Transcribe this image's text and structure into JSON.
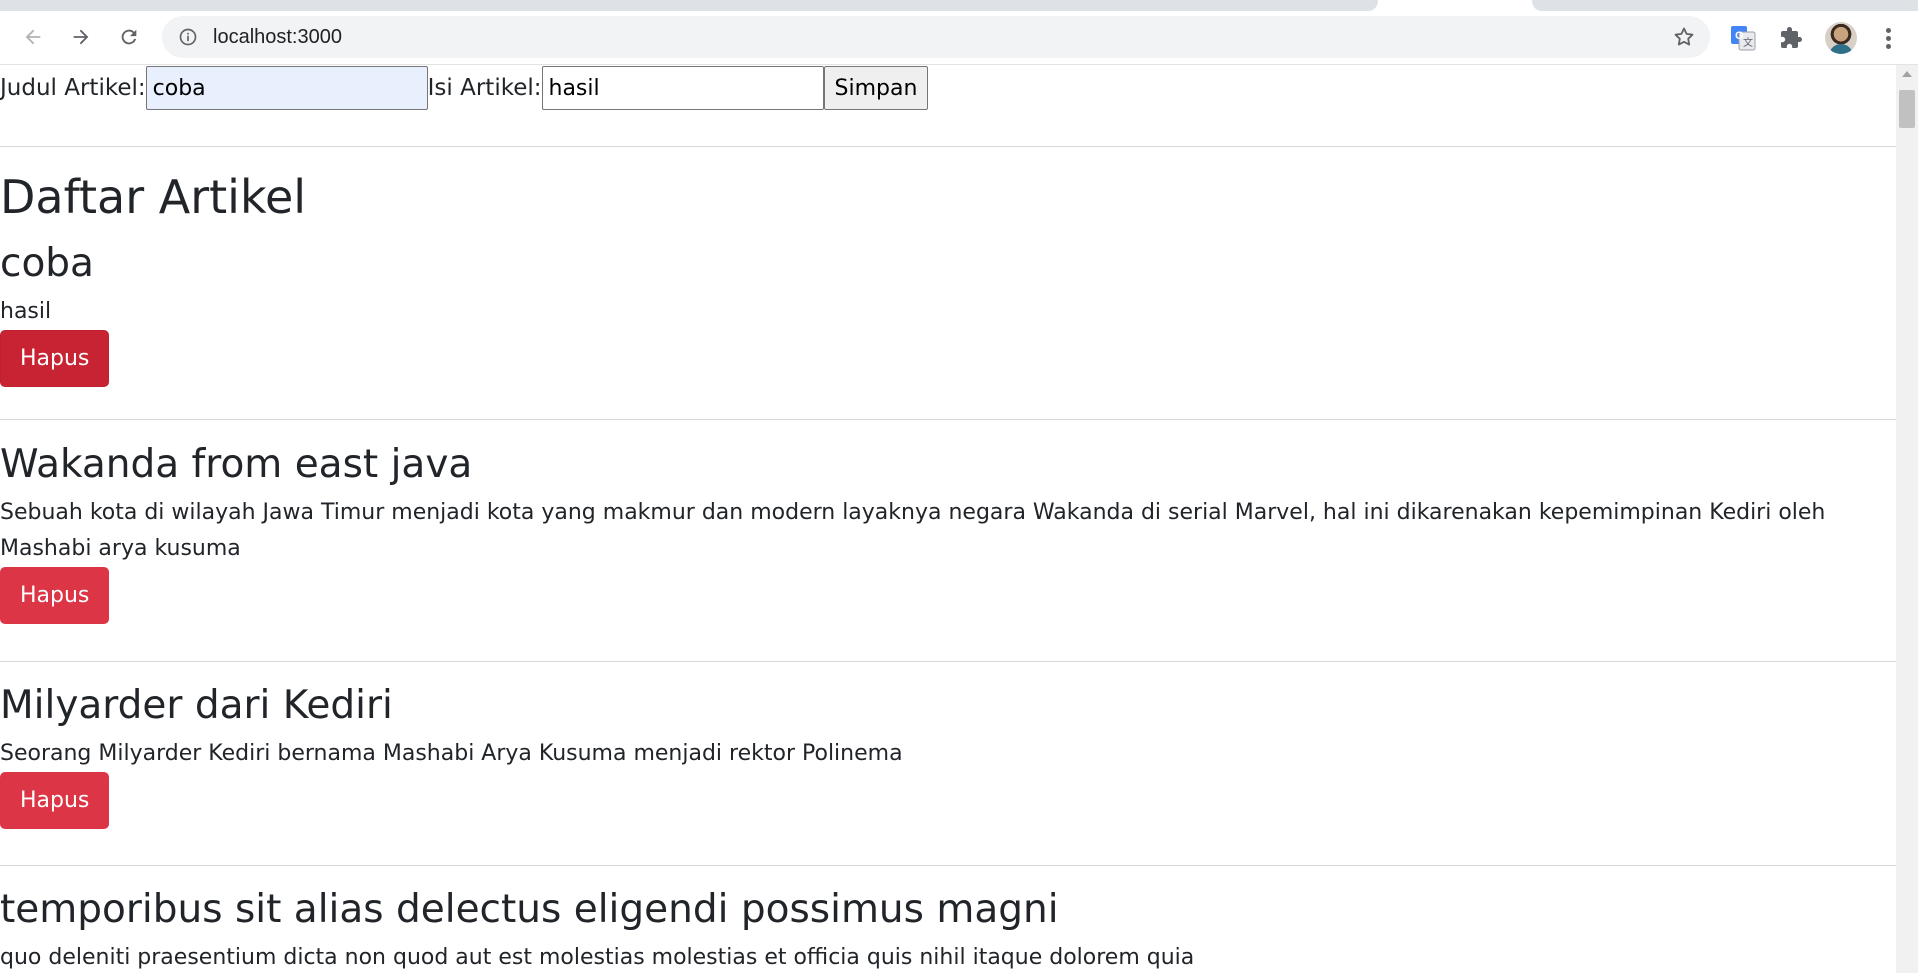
{
  "browser": {
    "url": "localhost:3000"
  },
  "form": {
    "judul_label": "Judul Artikel:",
    "judul_value": "coba",
    "isi_label": "Isi Artikel:",
    "isi_value": "hasil",
    "submit_label": "Simpan"
  },
  "page": {
    "title": "Daftar Artikel"
  },
  "articles": [
    {
      "title": "coba",
      "body": "hasil",
      "delete_label": "Hapus"
    },
    {
      "title": "Wakanda from east java",
      "body": "Sebuah kota di wilayah Jawa Timur menjadi kota yang makmur dan modern layaknya negara Wakanda di serial Marvel, hal ini dikarenakan kepemimpinan Kediri oleh Mashabi arya kusuma",
      "delete_label": "Hapus"
    },
    {
      "title": "Milyarder dari Kediri",
      "body": "Seorang Milyarder Kediri bernama Mashabi Arya Kusuma menjadi rektor Polinema",
      "delete_label": "Hapus"
    },
    {
      "title": "temporibus sit alias delectus eligendi possimus magni",
      "body": "quo deleniti praesentium dicta non quod aut est molestias molestias et officia quis nihil itaque dolorem quia"
    }
  ],
  "colors": {
    "danger": "#dc3545",
    "danger_hover": "#c82333",
    "autofill": "#e8f0fe"
  },
  "icons": [
    "back-arrow-icon",
    "forward-arrow-icon",
    "reload-icon",
    "info-icon",
    "star-icon",
    "translate-icon",
    "puzzle-extension-icon",
    "menu-dots-icon"
  ]
}
